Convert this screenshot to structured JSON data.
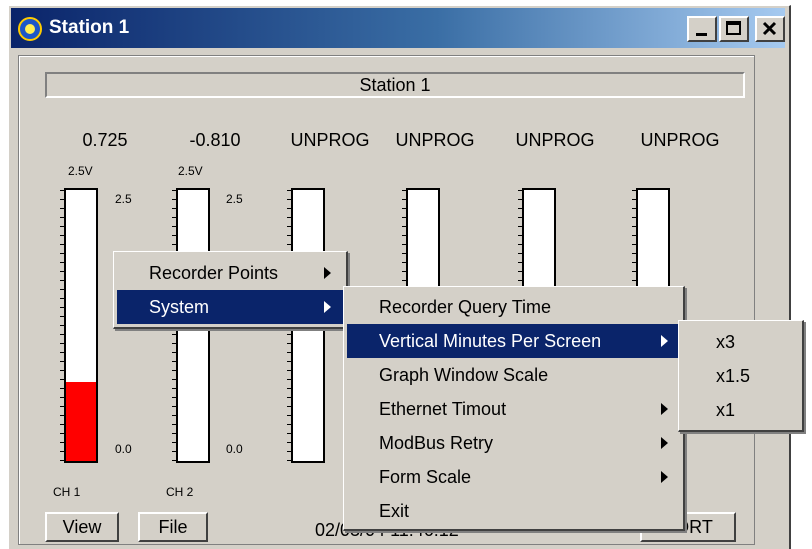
{
  "window": {
    "title": "Station 1"
  },
  "station": {
    "header": "Station 1"
  },
  "channels": [
    {
      "value": "0.725",
      "top_label": "2.5V",
      "scale_top": "2.5",
      "scale_bottom": "0.0",
      "name": "CH 1",
      "fill": 0.29
    },
    {
      "value": "-0.810",
      "top_label": "2.5V",
      "scale_top": "2.5",
      "scale_bottom": "0.0",
      "name": "CH 2",
      "fill": 0
    },
    {
      "value": "UNPROG"
    },
    {
      "value": "UNPROG"
    },
    {
      "value": "UNPROG"
    },
    {
      "value": "UNPROG"
    }
  ],
  "bottom": {
    "view": "View",
    "file": "File",
    "datetime": "02/03/04  11:46:12",
    "port": "PORT"
  },
  "menus": {
    "main": [
      {
        "label": "Recorder Points"
      },
      {
        "label": "System"
      }
    ],
    "system": [
      {
        "label": "Recorder Query Time"
      },
      {
        "label": "Vertical Minutes Per Screen"
      },
      {
        "label": "Graph Window Scale"
      },
      {
        "label": "Ethernet Timout"
      },
      {
        "label": "ModBus Retry"
      },
      {
        "label": "Form Scale"
      },
      {
        "label": "Exit"
      }
    ],
    "vertical_minutes": [
      {
        "label": "x3"
      },
      {
        "label": "x1.5"
      },
      {
        "label": "x1"
      }
    ]
  },
  "colors": {
    "titlebar": "#0a246a",
    "highlight": "#0a246a",
    "fill": "#ff0000",
    "face": "#d4d0c8"
  }
}
